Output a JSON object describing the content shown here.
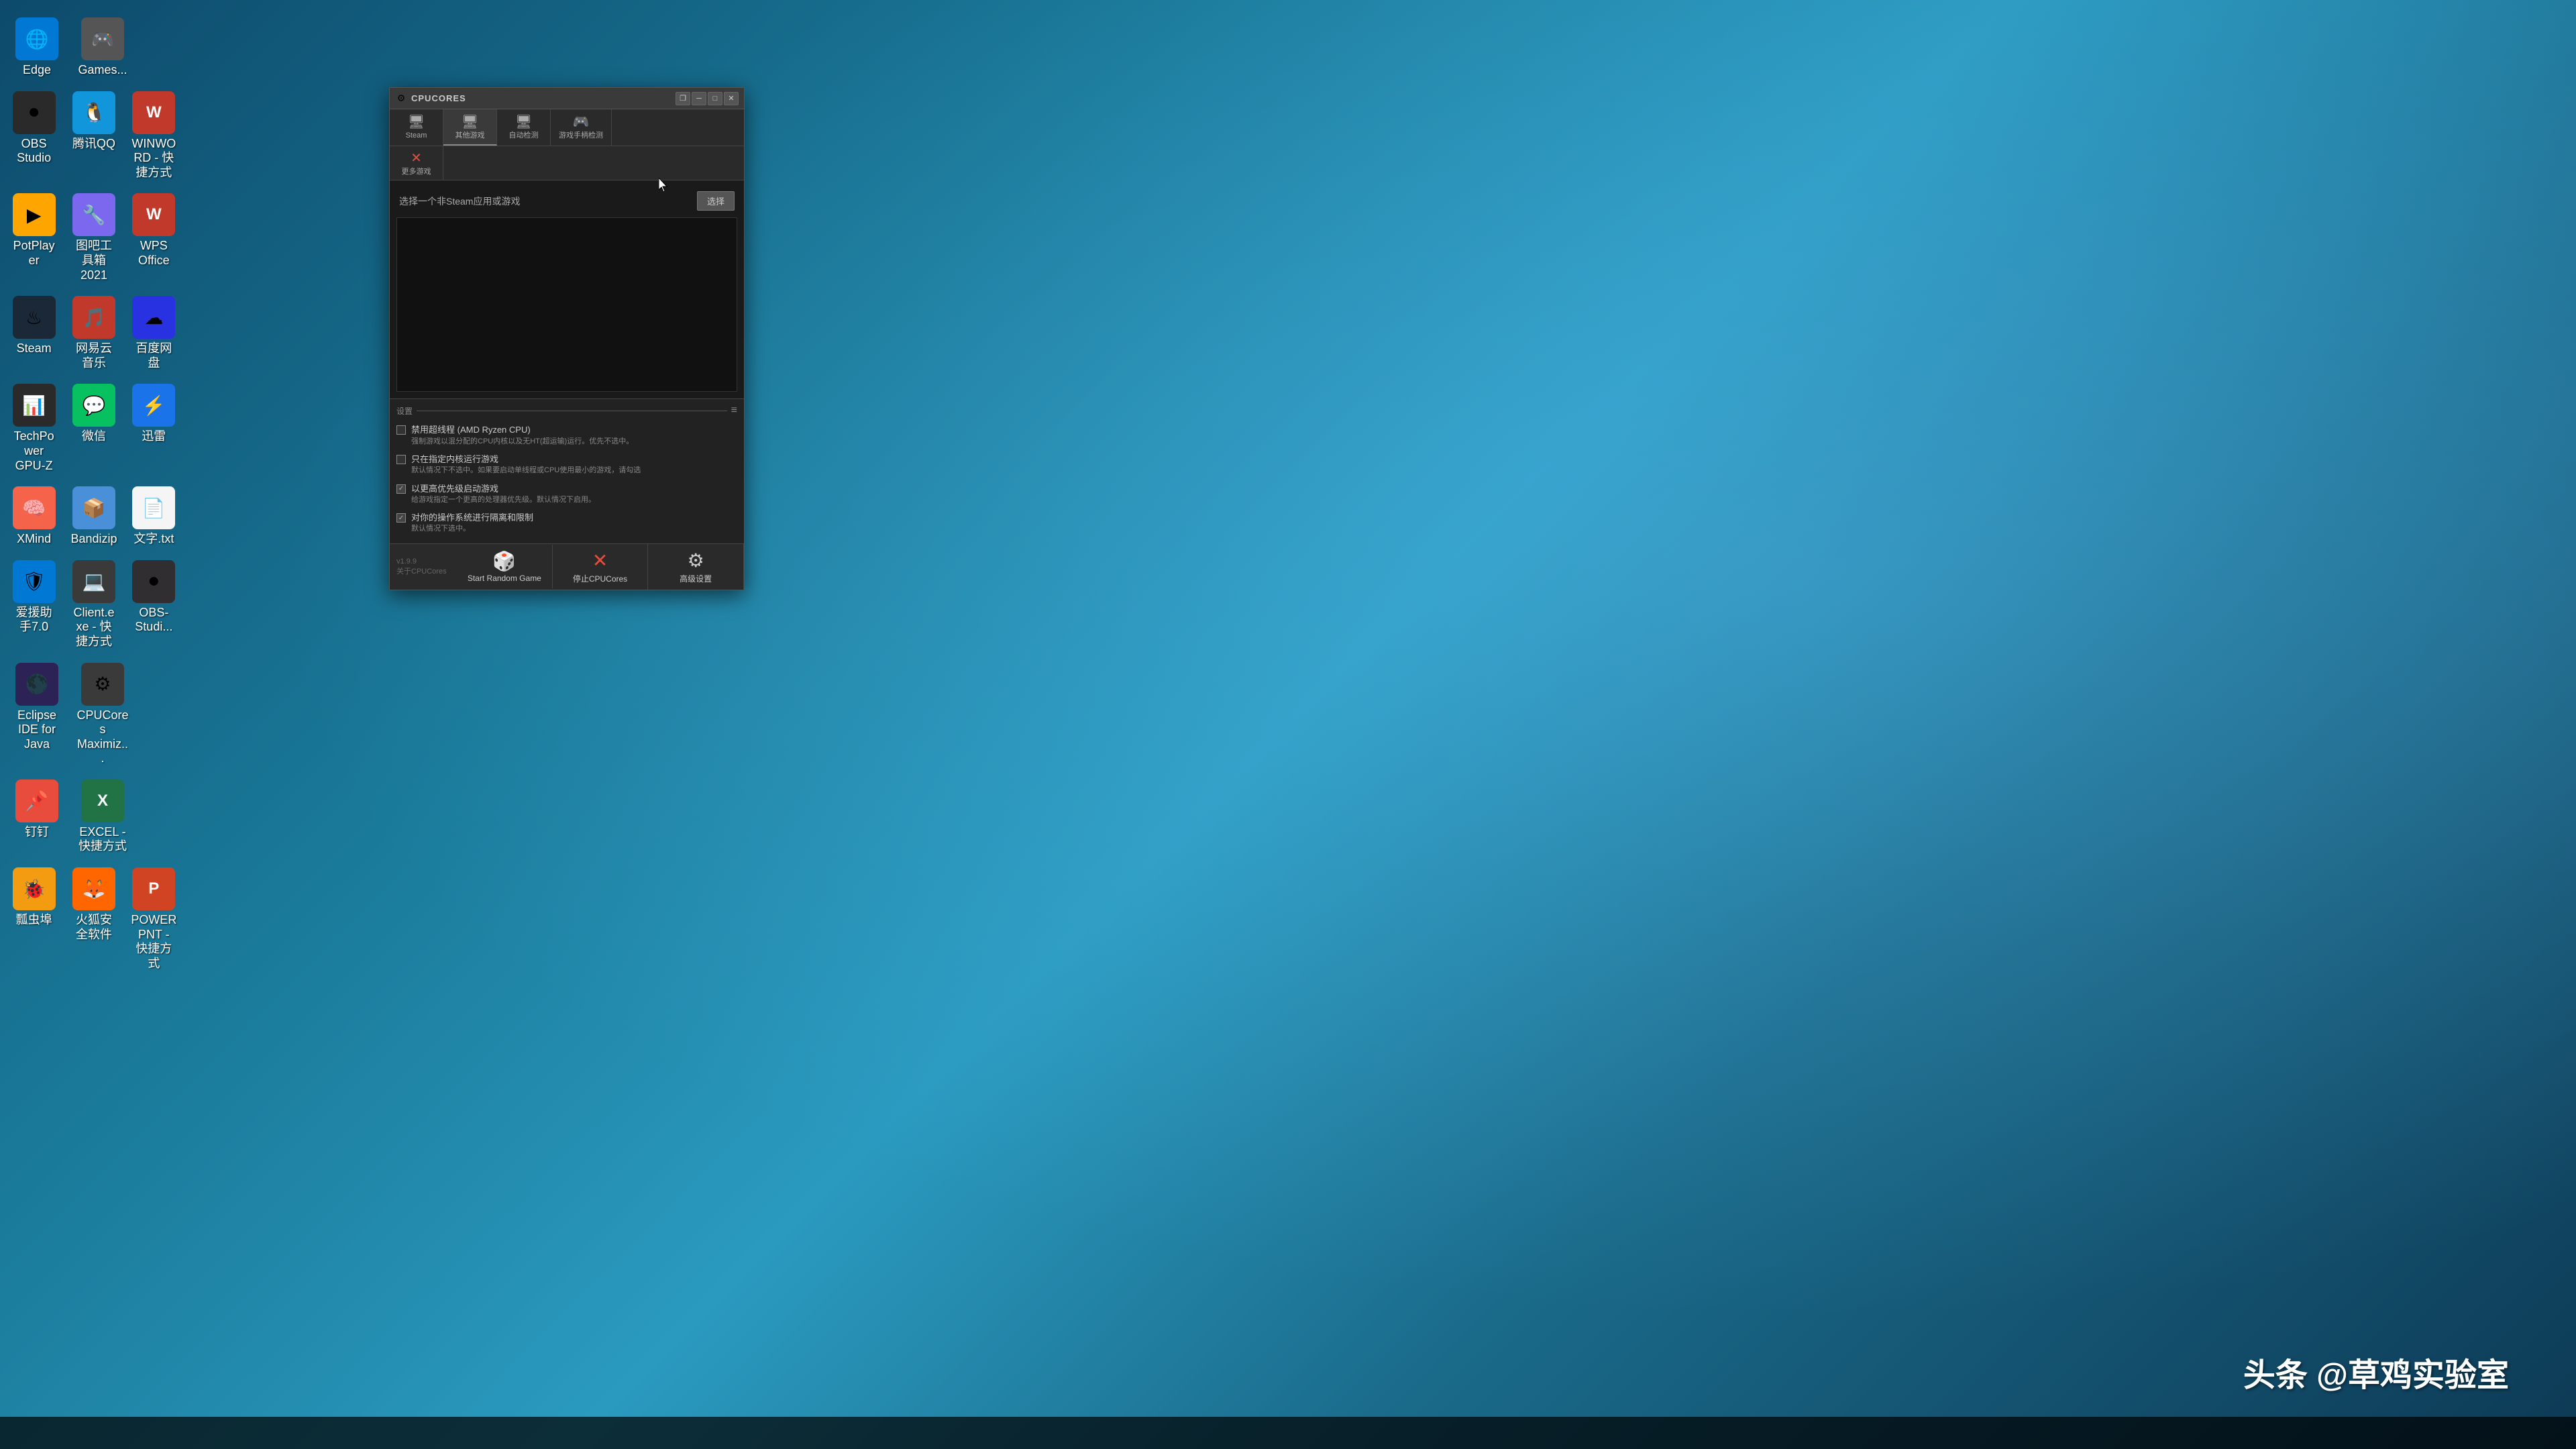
{
  "desktop": {
    "icons": [
      {
        "id": "edge",
        "label": "Edge",
        "color": "#0078d4",
        "emoji": "🌐",
        "col": 0
      },
      {
        "id": "games",
        "label": "Games...",
        "color": "#555",
        "emoji": "🎮",
        "col": 0
      },
      {
        "id": "obs",
        "label": "OBS Studio",
        "color": "#2a2a2a",
        "emoji": "⏺",
        "col": 0
      },
      {
        "id": "qq",
        "label": "腾讯QQ",
        "color": "#1296db",
        "emoji": "🐧",
        "col": 0
      },
      {
        "id": "wps",
        "label": "WINWORD - 快捷方式",
        "color": "#c0392b",
        "emoji": "W",
        "col": 0
      },
      {
        "id": "potplayer",
        "label": "PotPlayer",
        "color": "#ffa500",
        "emoji": "▶",
        "col": 0
      },
      {
        "id": "biji",
        "label": "图吧工具箱2021",
        "color": "#7b68ee",
        "emoji": "🔧",
        "col": 0
      },
      {
        "id": "wpsoffice",
        "label": "WPS Office",
        "color": "#c0392b",
        "emoji": "W",
        "col": 0
      },
      {
        "id": "steam",
        "label": "Steam",
        "color": "#1b2838",
        "emoji": "♨",
        "col": 0
      },
      {
        "id": "netease",
        "label": "网易云音乐",
        "color": "#c0392b",
        "emoji": "🎵",
        "col": 0
      },
      {
        "id": "baidu",
        "label": "百度网盘",
        "color": "#2932e1",
        "emoji": "☁",
        "col": 0
      },
      {
        "id": "techpow",
        "label": "TechPower GPU-Z",
        "color": "#2a2a2a",
        "emoji": "📊",
        "col": 0
      },
      {
        "id": "weixin",
        "label": "微信",
        "color": "#07c160",
        "emoji": "💬",
        "col": 0
      },
      {
        "id": "xunlei",
        "label": "迅雷",
        "color": "#1a73e8",
        "emoji": "⚡",
        "col": 0
      },
      {
        "id": "xmind",
        "label": "XMind",
        "color": "#f5634a",
        "emoji": "🧠",
        "col": 0
      },
      {
        "id": "bandizip",
        "label": "Bandizip",
        "color": "#4a90d9",
        "emoji": "📦",
        "col": 0
      },
      {
        "id": "wenjian",
        "label": "文字.txt",
        "color": "#f5f5f5",
        "emoji": "📄",
        "col": 0
      },
      {
        "id": "aiyuan",
        "label": "爱援助手7.0",
        "color": "#0078d4",
        "emoji": "🛡",
        "col": 0
      },
      {
        "id": "client",
        "label": "Client.exe - 快捷方式",
        "color": "#3a3a3a",
        "emoji": "💻",
        "col": 0
      },
      {
        "id": "obs2",
        "label": "OBS-Studi...",
        "color": "#302e31",
        "emoji": "⏺",
        "col": 0
      },
      {
        "id": "eclipse",
        "label": "Eclipse IDE for Java",
        "color": "#2c2255",
        "emoji": "🌑",
        "col": 0
      },
      {
        "id": "cpucores",
        "label": "CPUCores Maximiz...",
        "color": "#3a3a3a",
        "emoji": "⚙",
        "col": 0
      },
      {
        "id": "diaoyou",
        "label": "钉钉",
        "color": "#e74c3c",
        "emoji": "📌",
        "col": 0
      },
      {
        "id": "excel",
        "label": "EXCEL - 快捷方式",
        "color": "#217346",
        "emoji": "X",
        "col": 0
      },
      {
        "id": "piaoju",
        "label": "瓢虫埠",
        "color": "#f39c12",
        "emoji": "🐞",
        "col": 0
      },
      {
        "id": "huohu",
        "label": "火狐安全软件",
        "color": "#ff6600",
        "emoji": "🦊",
        "col": 0
      },
      {
        "id": "ppt",
        "label": "POWERPNT - 快捷方式",
        "color": "#d04423",
        "emoji": "P",
        "col": 0
      }
    ]
  },
  "watermark": {
    "text": "头条 @草鸡实验室"
  },
  "cpucores_window": {
    "title": "CPUCORES",
    "titlebar_controls": {
      "restore": "❐",
      "minimize": "─",
      "maximize": "□",
      "close": "✕"
    },
    "tabs_row1": [
      {
        "id": "steam",
        "icon": "🖥",
        "label": "Steam",
        "active": false
      },
      {
        "id": "other_games",
        "icon": "🖥",
        "label": "其他游戏",
        "active": true
      },
      {
        "id": "auto_detect",
        "icon": "🖥",
        "label": "自动检测",
        "active": false
      },
      {
        "id": "gamepad_detect",
        "icon": "🎮",
        "label": "游戏手柄检测",
        "active": false
      }
    ],
    "tabs_row2": [
      {
        "id": "more_games",
        "icon": "✕",
        "label": "更多游戏",
        "active": false
      }
    ],
    "app_select_label": "选择一个非Steam应用或游戏",
    "select_btn_label": "选择",
    "settings_label": "设置",
    "settings": [
      {
        "id": "disable_hyperthreading",
        "checked": false,
        "title": "禁用超线程 (AMD Ryzen CPU)",
        "desc": "强制游戏以混分配的CPU内核以及无HT(超运输)运行。优先不选中。"
      },
      {
        "id": "only_specific_core",
        "checked": false,
        "title": "只在指定内核运行游戏",
        "desc": "默认情况下不选中。如果要启动单线程或CPU使用最小的游戏，请勾选"
      },
      {
        "id": "high_priority",
        "checked": true,
        "title": "以更高优先级启动游戏",
        "desc": "给游戏指定一个更高的处理器优先级。默认情况下启用。"
      },
      {
        "id": "isolate_os",
        "checked": true,
        "title": "对你的操作系统进行隔离和限制",
        "desc": "默认情况下选中。"
      }
    ],
    "bottom_buttons": [
      {
        "id": "random_game",
        "icon": "🎲",
        "label": "Start Random Game"
      },
      {
        "id": "stop",
        "icon": "✕",
        "label": "停止CPUCores"
      },
      {
        "id": "advanced",
        "icon": "⚙",
        "label": "高级设置"
      }
    ],
    "version": "v1.9.9",
    "about_label": "关于CPUCores"
  }
}
